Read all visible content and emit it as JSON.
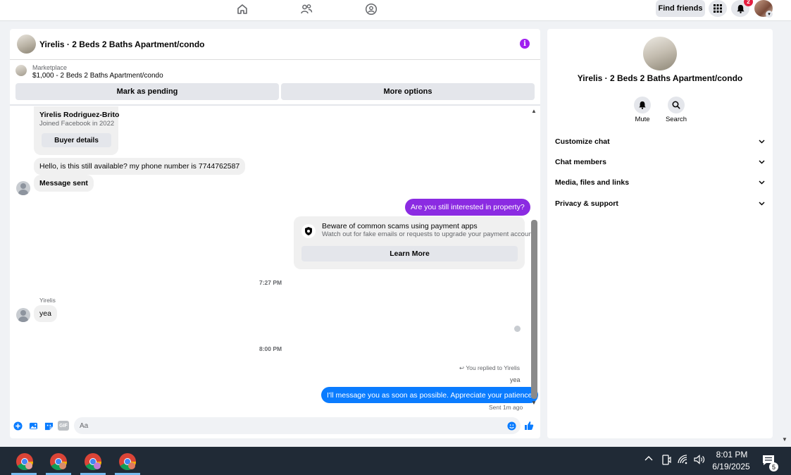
{
  "topbar": {
    "nav_icons": [
      "home-icon",
      "friends-icon",
      "groups-icon"
    ],
    "find_friends_label": "Find friends",
    "notification_count": "2"
  },
  "chat": {
    "title": "Yirelis · 2 Beds 2 Baths Apartment/condo",
    "marketplace_label": "Marketplace",
    "listing": "$1,000 - 2 Beds 2 Baths Apartment/condo",
    "mark_pending_label": "Mark as pending",
    "more_options_label": "More options",
    "buyer": {
      "name": "Yirelis Rodriguez-Brito",
      "joined": "Joined Facebook in 2022",
      "details_label": "Buyer details"
    },
    "messages": {
      "first_in": "Hello, is this still available? my phone number is 7744762587",
      "message_sent": "Message sent",
      "question_out": "Are you still interested in property?",
      "scam_title": "Beware of common scams using payment apps",
      "scam_desc": "Watch out for fake emails or requests to upgrade your payment account.",
      "learn_more": "Learn More",
      "time1": "7:27 PM",
      "sender": "Yirelis",
      "reply_in": "yea",
      "time2": "8:00 PM",
      "replied_to": "You replied to Yirelis",
      "quoted": "yea",
      "final_out": "I'll message you as soon as possible. Appreciate your patience",
      "sent_status": "Sent 1m ago"
    },
    "composer": {
      "placeholder": "Aa",
      "gif_label": "GIF"
    },
    "colors": {
      "purple": "#8b2be2",
      "blue": "#0a7cff"
    }
  },
  "info_panel": {
    "title": "Yirelis · 2 Beds 2 Baths Apartment/condo",
    "mute_label": "Mute",
    "search_label": "Search",
    "rows": [
      "Customize chat",
      "Chat members",
      "Media, files and links",
      "Privacy & support"
    ]
  },
  "taskbar": {
    "time": "8:01 PM",
    "date": "6/19/2025",
    "notification_count": "5"
  }
}
